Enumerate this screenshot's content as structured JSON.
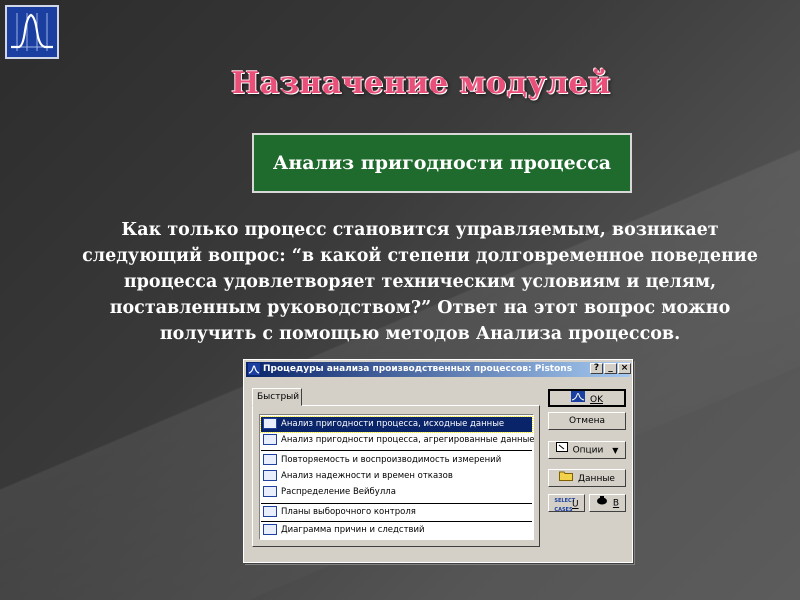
{
  "slide": {
    "title": "Назначение модулей",
    "module_label": "Анализ пригодности процесса",
    "body_text": "Как только процесс становится управляемым, возникает следующий вопрос: “в какой степени долговременное поведение процесса удовлетворяет техническим условиям и целям, поставленным руководством?” Ответ на этот вопрос можно получить с помощью методов Анализа процессов."
  },
  "dialog": {
    "title": "Процедуры анализа производственных процессов: Pistons",
    "title_buttons": [
      "?",
      "_",
      "×"
    ],
    "tab_label": "Быстрый",
    "items": [
      {
        "label": "Анализ пригодности процесса, исходные данные",
        "icon": "process-capability-icon",
        "selected": true
      },
      {
        "label": "Анализ пригодности процесса, агрегированные данные",
        "icon": "process-capability-icon",
        "selected": false
      },
      {
        "label": "Повторяемость и воспроизводимость измерений",
        "icon": "gage-rr-icon",
        "selected": false
      },
      {
        "label": "Анализ надежности и времен отказов",
        "icon": "reliability-icon",
        "selected": false
      },
      {
        "label": "Распределение Вейбулла",
        "icon": "weibull-icon",
        "selected": false
      },
      {
        "label": "Планы выборочного контроля",
        "icon": "sampling-plan-icon",
        "selected": false
      },
      {
        "label": "Диаграмма причин и следствий",
        "icon": "cause-effect-icon",
        "selected": false
      }
    ],
    "buttons": {
      "ok": "OK",
      "cancel": "Отмена",
      "options": "Опции",
      "data": "Данные",
      "select_cases_icon_text": "SELECT CASES",
      "select_cases_hotkey": "U",
      "weight_hotkey": "B"
    }
  },
  "colors": {
    "title_pink": "#e8507a",
    "green_box": "#1f6a2d",
    "selection_blue": "#0a246a"
  }
}
